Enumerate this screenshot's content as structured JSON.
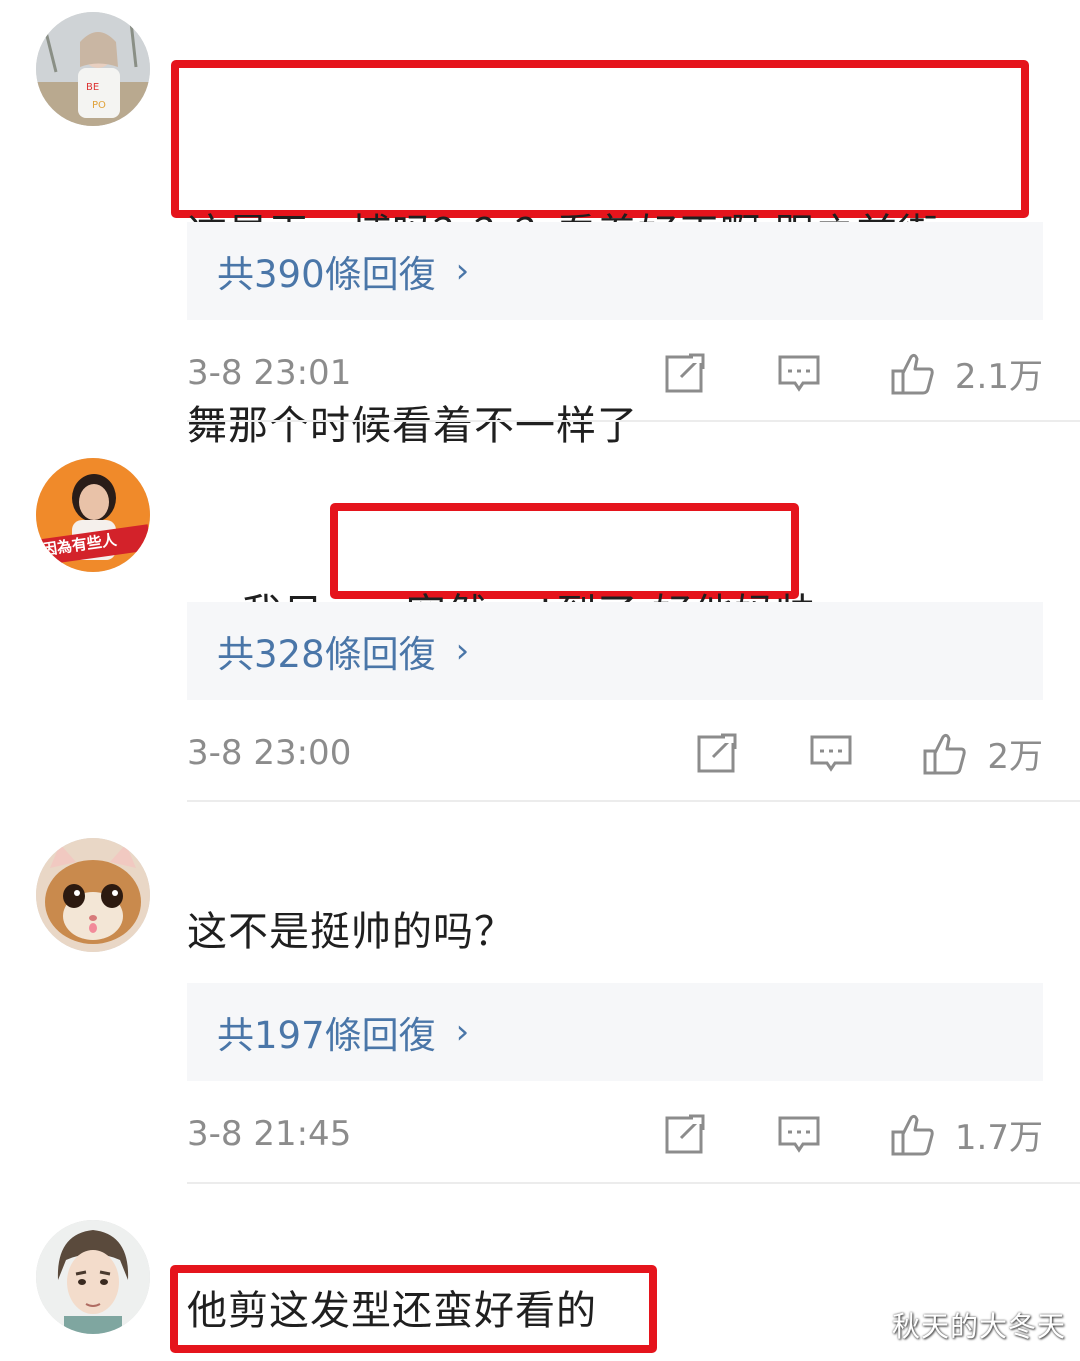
{
  "comments": [
    {
      "text_line1": "这是王一博吗？？？看着好正啊 跟之前街",
      "text_line2": "舞那个时候看着不一样了",
      "reply_label": "共390條回復",
      "timestamp": "3-8 23:01",
      "likes": "2.1万"
    },
    {
      "text_prefix": "我日……",
      "text_highlight": "突然get到了 好他妈帅",
      "reply_label": "共328條回復",
      "timestamp": "3-8 23:00",
      "likes": "2万"
    },
    {
      "text": "这不是挺帅的吗？",
      "reply_label": "共197條回復",
      "timestamp": "3-8 21:45",
      "likes": "1.7万"
    },
    {
      "text": "他剪这发型还蛮好看的"
    }
  ],
  "icons": {
    "chevron": "chevron-right-icon",
    "share": "share-icon",
    "comment": "comment-icon",
    "like": "thumbs-up-icon"
  },
  "colors": {
    "highlight": "#e5141c",
    "link": "#4a76a8",
    "meta": "#8c8c8c",
    "reply_bg": "#f6f7f9"
  },
  "watermark": "秋天的大冬天"
}
